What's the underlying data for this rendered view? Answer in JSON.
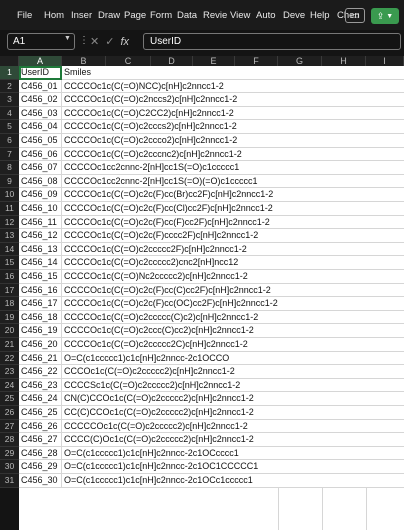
{
  "menu": [
    "File",
    "Hom",
    "Inser",
    "Draw",
    "Page",
    "Form",
    "Data",
    "Revie",
    "View",
    "Auto",
    "Deve",
    "Help",
    "Chen"
  ],
  "namebox": "A1",
  "formula_value": "UserID",
  "fx_label": "fx",
  "columns": [
    "A",
    "B",
    "C",
    "D",
    "E",
    "F",
    "G",
    "H",
    "I"
  ],
  "rows": [
    {
      "n": "1",
      "a": "UserID",
      "b": "Smiles"
    },
    {
      "n": "2",
      "a": "C456_01",
      "b": "CCCCOc1c(C(=O)NCC)c[nH]c2nncc1-2"
    },
    {
      "n": "3",
      "a": "C456_02",
      "b": "CCCCOc1c(C(=O)c2nccs2)c[nH]c2nncc1-2"
    },
    {
      "n": "4",
      "a": "C456_03",
      "b": "CCCCOc1c(C(=O)C2CC2)c[nH]c2nncc1-2"
    },
    {
      "n": "5",
      "a": "C456_04",
      "b": "CCCCOc1c(C(=O)c2cccs2)c[nH]c2nncc1-2"
    },
    {
      "n": "6",
      "a": "C456_05",
      "b": "CCCCOc1c(C(=O)c2ccco2)c[nH]c2nncc1-2"
    },
    {
      "n": "7",
      "a": "C456_06",
      "b": "CCCCOc1c(C(=O)c2cccnc2)c[nH]c2nncc1-2"
    },
    {
      "n": "8",
      "a": "C456_07",
      "b": "CCCCOc1cc2cnnc-2[nH]cc1S(=O)c1ccccc1"
    },
    {
      "n": "9",
      "a": "C456_08",
      "b": "CCCCOc1cc2cnnc-2[nH]cc1S(=O)(=O)c1ccccc1"
    },
    {
      "n": "10",
      "a": "C456_09",
      "b": "CCCCOc1c(C(=O)c2c(F)cc(Br)cc2F)c[nH]c2nncc1-2"
    },
    {
      "n": "11",
      "a": "C456_10",
      "b": "CCCCOc1c(C(=O)c2c(F)cc(Cl)cc2F)c[nH]c2nncc1-2"
    },
    {
      "n": "12",
      "a": "C456_11",
      "b": "CCCCOc1c(C(=O)c2c(F)cc(F)cc2F)c[nH]c2nncc1-2"
    },
    {
      "n": "13",
      "a": "C456_12",
      "b": "CCCCOc1c(C(=O)c2c(F)cccc2F)c[nH]c2nncc1-2"
    },
    {
      "n": "14",
      "a": "C456_13",
      "b": "CCCCOc1c(C(=O)c2ccccc2F)c[nH]c2nncc1-2"
    },
    {
      "n": "15",
      "a": "C456_14",
      "b": "CCCCOc1c(C(=O)c2ccccc2)cnc2[nH]ncc12"
    },
    {
      "n": "16",
      "a": "C456_15",
      "b": "CCCCOc1c(C(=O)Nc2ccccc2)c[nH]c2nncc1-2"
    },
    {
      "n": "17",
      "a": "C456_16",
      "b": "CCCCOc1c(C(=O)c2c(F)cc(C)cc2F)c[nH]c2nncc1-2"
    },
    {
      "n": "18",
      "a": "C456_17",
      "b": "CCCCOc1c(C(=O)c2c(F)cc(OC)cc2F)c[nH]c2nncc1-2"
    },
    {
      "n": "19",
      "a": "C456_18",
      "b": "CCCCOc1c(C(=O)c2ccccc(C)c2)c[nH]c2nncc1-2"
    },
    {
      "n": "20",
      "a": "C456_19",
      "b": "CCCCOc1c(C(=O)c2ccc(C)cc2)c[nH]c2nncc1-2"
    },
    {
      "n": "21",
      "a": "C456_20",
      "b": "CCCCOc1c(C(=O)c2ccccc2C)c[nH]c2nncc1-2"
    },
    {
      "n": "22",
      "a": "C456_21",
      "b": "O=C(c1ccccc1)c1c[nH]c2nncc-2c1OCCO"
    },
    {
      "n": "23",
      "a": "C456_22",
      "b": "CCCOc1c(C(=O)c2ccccc2)c[nH]c2nncc1-2"
    },
    {
      "n": "24",
      "a": "C456_23",
      "b": "CCCCSc1c(C(=O)c2ccccc2)c[nH]c2nncc1-2"
    },
    {
      "n": "25",
      "a": "C456_24",
      "b": "CN(C)CCOc1c(C(=O)c2ccccc2)c[nH]c2nncc1-2"
    },
    {
      "n": "26",
      "a": "C456_25",
      "b": "CC(C)CCOc1c(C(=O)c2ccccc2)c[nH]c2nncc1-2"
    },
    {
      "n": "27",
      "a": "C456_26",
      "b": "CCCCCOc1c(C(=O)c2ccccc2)c[nH]c2nncc1-2"
    },
    {
      "n": "28",
      "a": "C456_27",
      "b": "CCCC(C)Oc1c(C(=O)c2ccccc2)c[nH]c2nncc1-2"
    },
    {
      "n": "29",
      "a": "C456_28",
      "b": "O=C(c1ccccc1)c1c[nH]c2nncc-2c1OCcccc1"
    },
    {
      "n": "30",
      "a": "C456_29",
      "b": "O=C(c1ccccc1)c1c[nH]c2nncc-2c1OC1CCCCC1"
    },
    {
      "n": "31",
      "a": "C456_30",
      "b": "O=C(c1ccccc1)c1c[nH]c2nncc-2c1OCc1ccccc1"
    }
  ]
}
